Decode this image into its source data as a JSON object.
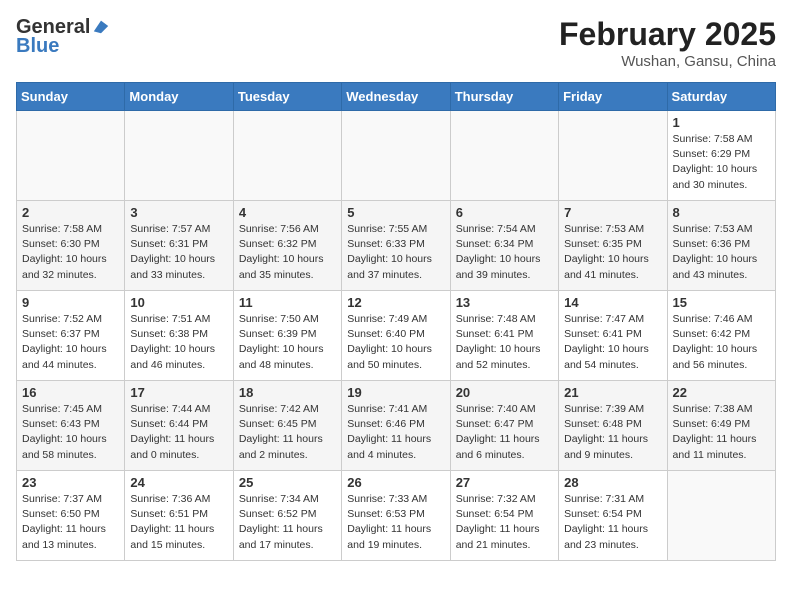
{
  "header": {
    "logo_line1": "General",
    "logo_line2": "Blue",
    "month_year": "February 2025",
    "location": "Wushan, Gansu, China"
  },
  "weekdays": [
    "Sunday",
    "Monday",
    "Tuesday",
    "Wednesday",
    "Thursday",
    "Friday",
    "Saturday"
  ],
  "weeks": [
    [
      {
        "day": "",
        "info": ""
      },
      {
        "day": "",
        "info": ""
      },
      {
        "day": "",
        "info": ""
      },
      {
        "day": "",
        "info": ""
      },
      {
        "day": "",
        "info": ""
      },
      {
        "day": "",
        "info": ""
      },
      {
        "day": "1",
        "info": "Sunrise: 7:58 AM\nSunset: 6:29 PM\nDaylight: 10 hours and 30 minutes."
      }
    ],
    [
      {
        "day": "2",
        "info": "Sunrise: 7:58 AM\nSunset: 6:30 PM\nDaylight: 10 hours and 32 minutes."
      },
      {
        "day": "3",
        "info": "Sunrise: 7:57 AM\nSunset: 6:31 PM\nDaylight: 10 hours and 33 minutes."
      },
      {
        "day": "4",
        "info": "Sunrise: 7:56 AM\nSunset: 6:32 PM\nDaylight: 10 hours and 35 minutes."
      },
      {
        "day": "5",
        "info": "Sunrise: 7:55 AM\nSunset: 6:33 PM\nDaylight: 10 hours and 37 minutes."
      },
      {
        "day": "6",
        "info": "Sunrise: 7:54 AM\nSunset: 6:34 PM\nDaylight: 10 hours and 39 minutes."
      },
      {
        "day": "7",
        "info": "Sunrise: 7:53 AM\nSunset: 6:35 PM\nDaylight: 10 hours and 41 minutes."
      },
      {
        "day": "8",
        "info": "Sunrise: 7:53 AM\nSunset: 6:36 PM\nDaylight: 10 hours and 43 minutes."
      }
    ],
    [
      {
        "day": "9",
        "info": "Sunrise: 7:52 AM\nSunset: 6:37 PM\nDaylight: 10 hours and 44 minutes."
      },
      {
        "day": "10",
        "info": "Sunrise: 7:51 AM\nSunset: 6:38 PM\nDaylight: 10 hours and 46 minutes."
      },
      {
        "day": "11",
        "info": "Sunrise: 7:50 AM\nSunset: 6:39 PM\nDaylight: 10 hours and 48 minutes."
      },
      {
        "day": "12",
        "info": "Sunrise: 7:49 AM\nSunset: 6:40 PM\nDaylight: 10 hours and 50 minutes."
      },
      {
        "day": "13",
        "info": "Sunrise: 7:48 AM\nSunset: 6:41 PM\nDaylight: 10 hours and 52 minutes."
      },
      {
        "day": "14",
        "info": "Sunrise: 7:47 AM\nSunset: 6:41 PM\nDaylight: 10 hours and 54 minutes."
      },
      {
        "day": "15",
        "info": "Sunrise: 7:46 AM\nSunset: 6:42 PM\nDaylight: 10 hours and 56 minutes."
      }
    ],
    [
      {
        "day": "16",
        "info": "Sunrise: 7:45 AM\nSunset: 6:43 PM\nDaylight: 10 hours and 58 minutes."
      },
      {
        "day": "17",
        "info": "Sunrise: 7:44 AM\nSunset: 6:44 PM\nDaylight: 11 hours and 0 minutes."
      },
      {
        "day": "18",
        "info": "Sunrise: 7:42 AM\nSunset: 6:45 PM\nDaylight: 11 hours and 2 minutes."
      },
      {
        "day": "19",
        "info": "Sunrise: 7:41 AM\nSunset: 6:46 PM\nDaylight: 11 hours and 4 minutes."
      },
      {
        "day": "20",
        "info": "Sunrise: 7:40 AM\nSunset: 6:47 PM\nDaylight: 11 hours and 6 minutes."
      },
      {
        "day": "21",
        "info": "Sunrise: 7:39 AM\nSunset: 6:48 PM\nDaylight: 11 hours and 9 minutes."
      },
      {
        "day": "22",
        "info": "Sunrise: 7:38 AM\nSunset: 6:49 PM\nDaylight: 11 hours and 11 minutes."
      }
    ],
    [
      {
        "day": "23",
        "info": "Sunrise: 7:37 AM\nSunset: 6:50 PM\nDaylight: 11 hours and 13 minutes."
      },
      {
        "day": "24",
        "info": "Sunrise: 7:36 AM\nSunset: 6:51 PM\nDaylight: 11 hours and 15 minutes."
      },
      {
        "day": "25",
        "info": "Sunrise: 7:34 AM\nSunset: 6:52 PM\nDaylight: 11 hours and 17 minutes."
      },
      {
        "day": "26",
        "info": "Sunrise: 7:33 AM\nSunset: 6:53 PM\nDaylight: 11 hours and 19 minutes."
      },
      {
        "day": "27",
        "info": "Sunrise: 7:32 AM\nSunset: 6:54 PM\nDaylight: 11 hours and 21 minutes."
      },
      {
        "day": "28",
        "info": "Sunrise: 7:31 AM\nSunset: 6:54 PM\nDaylight: 11 hours and 23 minutes."
      },
      {
        "day": "",
        "info": ""
      }
    ]
  ]
}
